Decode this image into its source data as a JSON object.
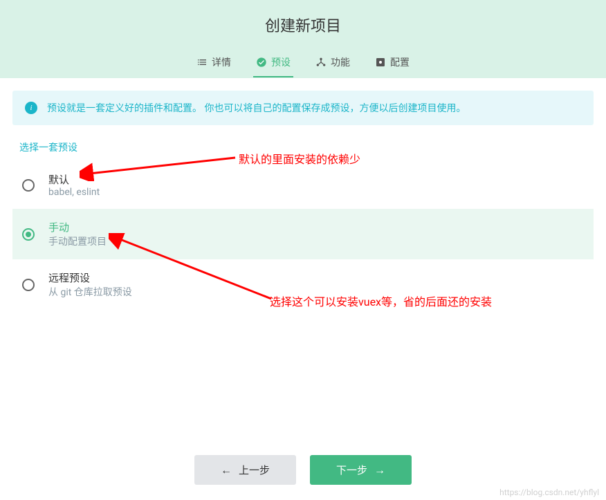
{
  "header": {
    "title": "创建新项目"
  },
  "tabs": [
    {
      "label": "详情",
      "icon": "list"
    },
    {
      "label": "预设",
      "icon": "check-circle"
    },
    {
      "label": "功能",
      "icon": "hub"
    },
    {
      "label": "配置",
      "icon": "settings-box"
    }
  ],
  "info": {
    "text": "预设就是一套定义好的插件和配置。 你也可以将自己的配置保存成预设，方便以后创建项目使用。"
  },
  "section_label": "选择一套预设",
  "presets": [
    {
      "title": "默认",
      "subtitle": "babel, eslint",
      "selected": false
    },
    {
      "title": "手动",
      "subtitle": "手动配置项目",
      "selected": true
    },
    {
      "title": "远程预设",
      "subtitle": "从 git 仓库拉取预设",
      "selected": false
    }
  ],
  "buttons": {
    "prev": "上一步",
    "next": "下一步"
  },
  "annotations": {
    "a1": "默认的里面安装的依赖少",
    "a2": "选择这个可以安装vuex等，省的后面还的安装"
  },
  "watermark": "https://blog.csdn.net/yhflyl"
}
